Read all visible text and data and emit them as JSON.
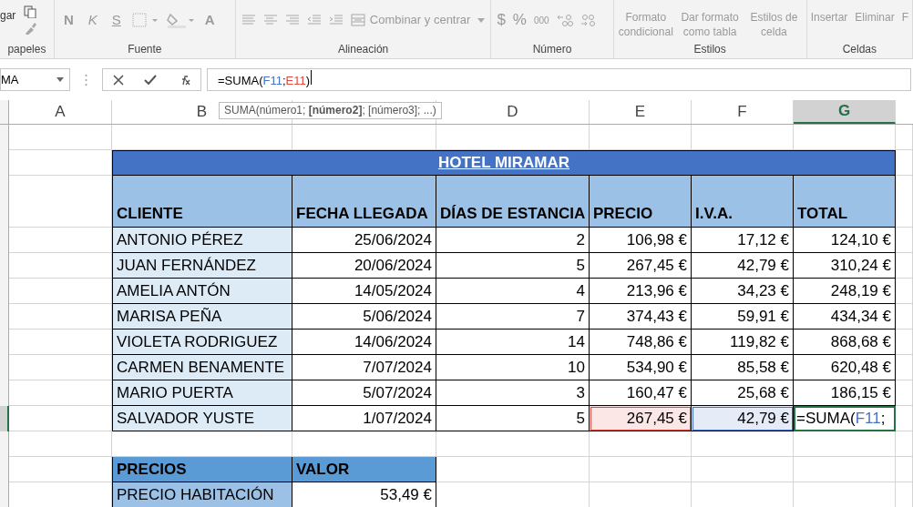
{
  "ribbon": {
    "disabled": true,
    "groups": [
      {
        "label": "papeles",
        "texts": [
          "gar"
        ]
      },
      {
        "label": "Fuente",
        "texts": [
          "N",
          "K",
          "S",
          "A"
        ]
      },
      {
        "label": "Alineación",
        "texts": [
          "Combinar y centrar"
        ]
      },
      {
        "label": "Número",
        "texts": [
          "$",
          "%",
          "000"
        ]
      },
      {
        "label": "Estilos",
        "texts": [
          "Formato condicional",
          "Dar formato como tabla",
          "Estilos de celda"
        ]
      },
      {
        "label": "Celdas",
        "texts": [
          "Insertar",
          "Eliminar",
          "F"
        ]
      }
    ]
  },
  "formula_bar": {
    "name_box": "MA",
    "formula": [
      {
        "text": "=SUMA("
      },
      {
        "text": "F11",
        "color": "#4472c4"
      },
      {
        "text": ";"
      },
      {
        "text": "E11",
        "color": "#e0483e"
      },
      {
        "text": ")"
      }
    ]
  },
  "tooltip": "SUMA(número1; **[número2]**; [número3]; ...)",
  "columns": [
    {
      "label": "A",
      "selected": false
    },
    {
      "label": "B",
      "selected": false
    },
    {
      "label": "D",
      "selected": false
    },
    {
      "label": "E",
      "selected": false
    },
    {
      "label": "F",
      "selected": false
    },
    {
      "label": "G",
      "selected": true
    }
  ],
  "table": {
    "title": "HOTEL MIRAMAR",
    "columns": [
      "CLIENTE",
      "FECHA  LLEGADA",
      "DÍAS DE ESTANCIA",
      "PRECIO",
      "I.V.A.",
      "TOTAL"
    ],
    "rows": [
      [
        "ANTONIO PÉREZ",
        "25/06/2024",
        "2",
        "106,98 €",
        "17,12 €",
        "124,10 €"
      ],
      [
        "JUAN FERNÁNDEZ",
        "20/06/2024",
        "5",
        "267,45 €",
        "42,79 €",
        "310,24 €"
      ],
      [
        "AMELIA ANTÓN",
        "14/05/2024",
        "4",
        "213,96 €",
        "34,23 €",
        "248,19 €"
      ],
      [
        "MARISA PEÑA",
        "5/06/2024",
        "7",
        "374,43 €",
        "59,91 €",
        "434,34 €"
      ],
      [
        "VIOLETA RODRIGUEZ",
        "14/06/2024",
        "14",
        "748,86 €",
        "119,82 €",
        "868,68 €"
      ],
      [
        "CARMEN BENAMENTE",
        "7/07/2024",
        "10",
        "534,90 €",
        "85,58 €",
        "620,48 €"
      ],
      [
        "MARIO PUERTA",
        "5/07/2024",
        "3",
        "160,47 €",
        "25,68 €",
        "186,15 €"
      ]
    ],
    "editing_row": {
      "cells": [
        {
          "text": "SALVADOR YUSTE"
        },
        {
          "text": "1/07/2024"
        },
        {
          "text": "5"
        },
        {
          "text": "267,45 €",
          "color": "#e0483e"
        },
        {
          "text": "42,79 €",
          "color": "#4472c4"
        }
      ],
      "input": [
        {
          "text": "=SUMA("
        },
        {
          "text": "F11",
          "color": "#4472c4"
        },
        {
          "text": ";"
        }
      ]
    }
  },
  "prices": {
    "columns": [
      "PRECIOS",
      "VALOR"
    ],
    "rows": [
      [
        "PRECIO HABITACIÓN",
        "53,49 €"
      ]
    ]
  }
}
